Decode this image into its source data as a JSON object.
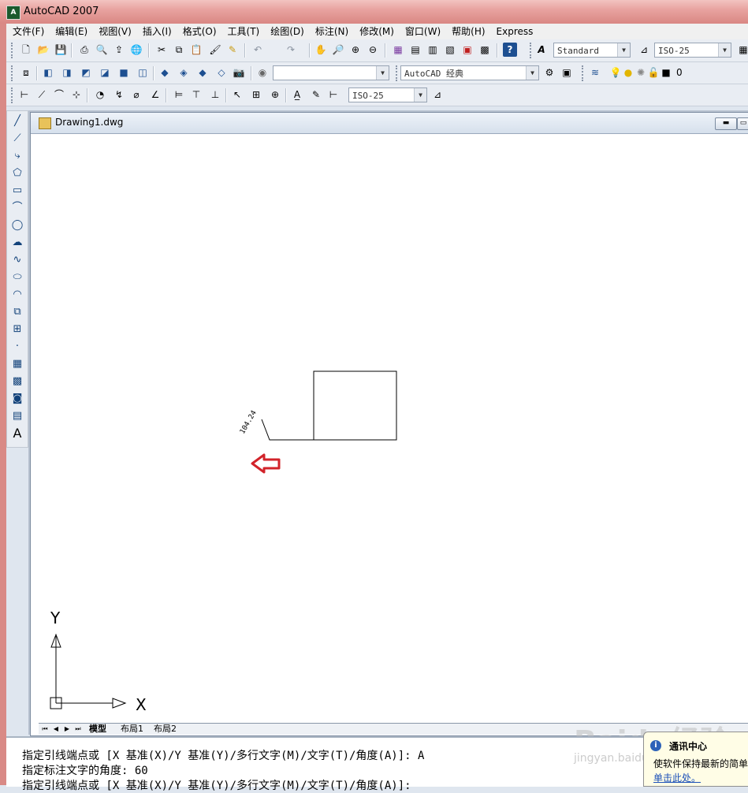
{
  "window": {
    "title": "AutoCAD 2007",
    "app_icon": "autocad-logo-icon"
  },
  "menu": [
    "文件(F)",
    "编辑(E)",
    "视图(V)",
    "插入(I)",
    "格式(O)",
    "工具(T)",
    "绘图(D)",
    "标注(N)",
    "修改(M)",
    "窗口(W)",
    "帮助(H)",
    "Express"
  ],
  "toolbar": {
    "text_style": "Standard",
    "dim_style": "ISO-25",
    "workspace": "AutoCAD 经典",
    "layer": "0",
    "dim_style_2": "ISO-25"
  },
  "document": {
    "title": "Drawing1.dwg"
  },
  "drawing": {
    "dimension_text": "104.24",
    "ucs_x_label": "X",
    "ucs_y_label": "Y",
    "arrow_color": "#d2232a"
  },
  "layout_tabs": [
    "模型",
    "布局1",
    "布局2"
  ],
  "command_lines": [
    "指定引线端点或 [X 基准(X)/Y 基准(Y)/多行文字(M)/文字(T)/角度(A)]: A",
    "指定标注文字的角度: 60",
    "指定引线端点或 [X 基准(X)/Y 基准(Y)/多行文字(M)/文字(T)/角度(A)]:"
  ],
  "notification": {
    "title": "通讯中心",
    "body": "使软件保持最新的简单",
    "link": "单击此处。"
  },
  "watermark": {
    "brand": "Baidu经验",
    "url": "jingyan.baidu.com"
  }
}
